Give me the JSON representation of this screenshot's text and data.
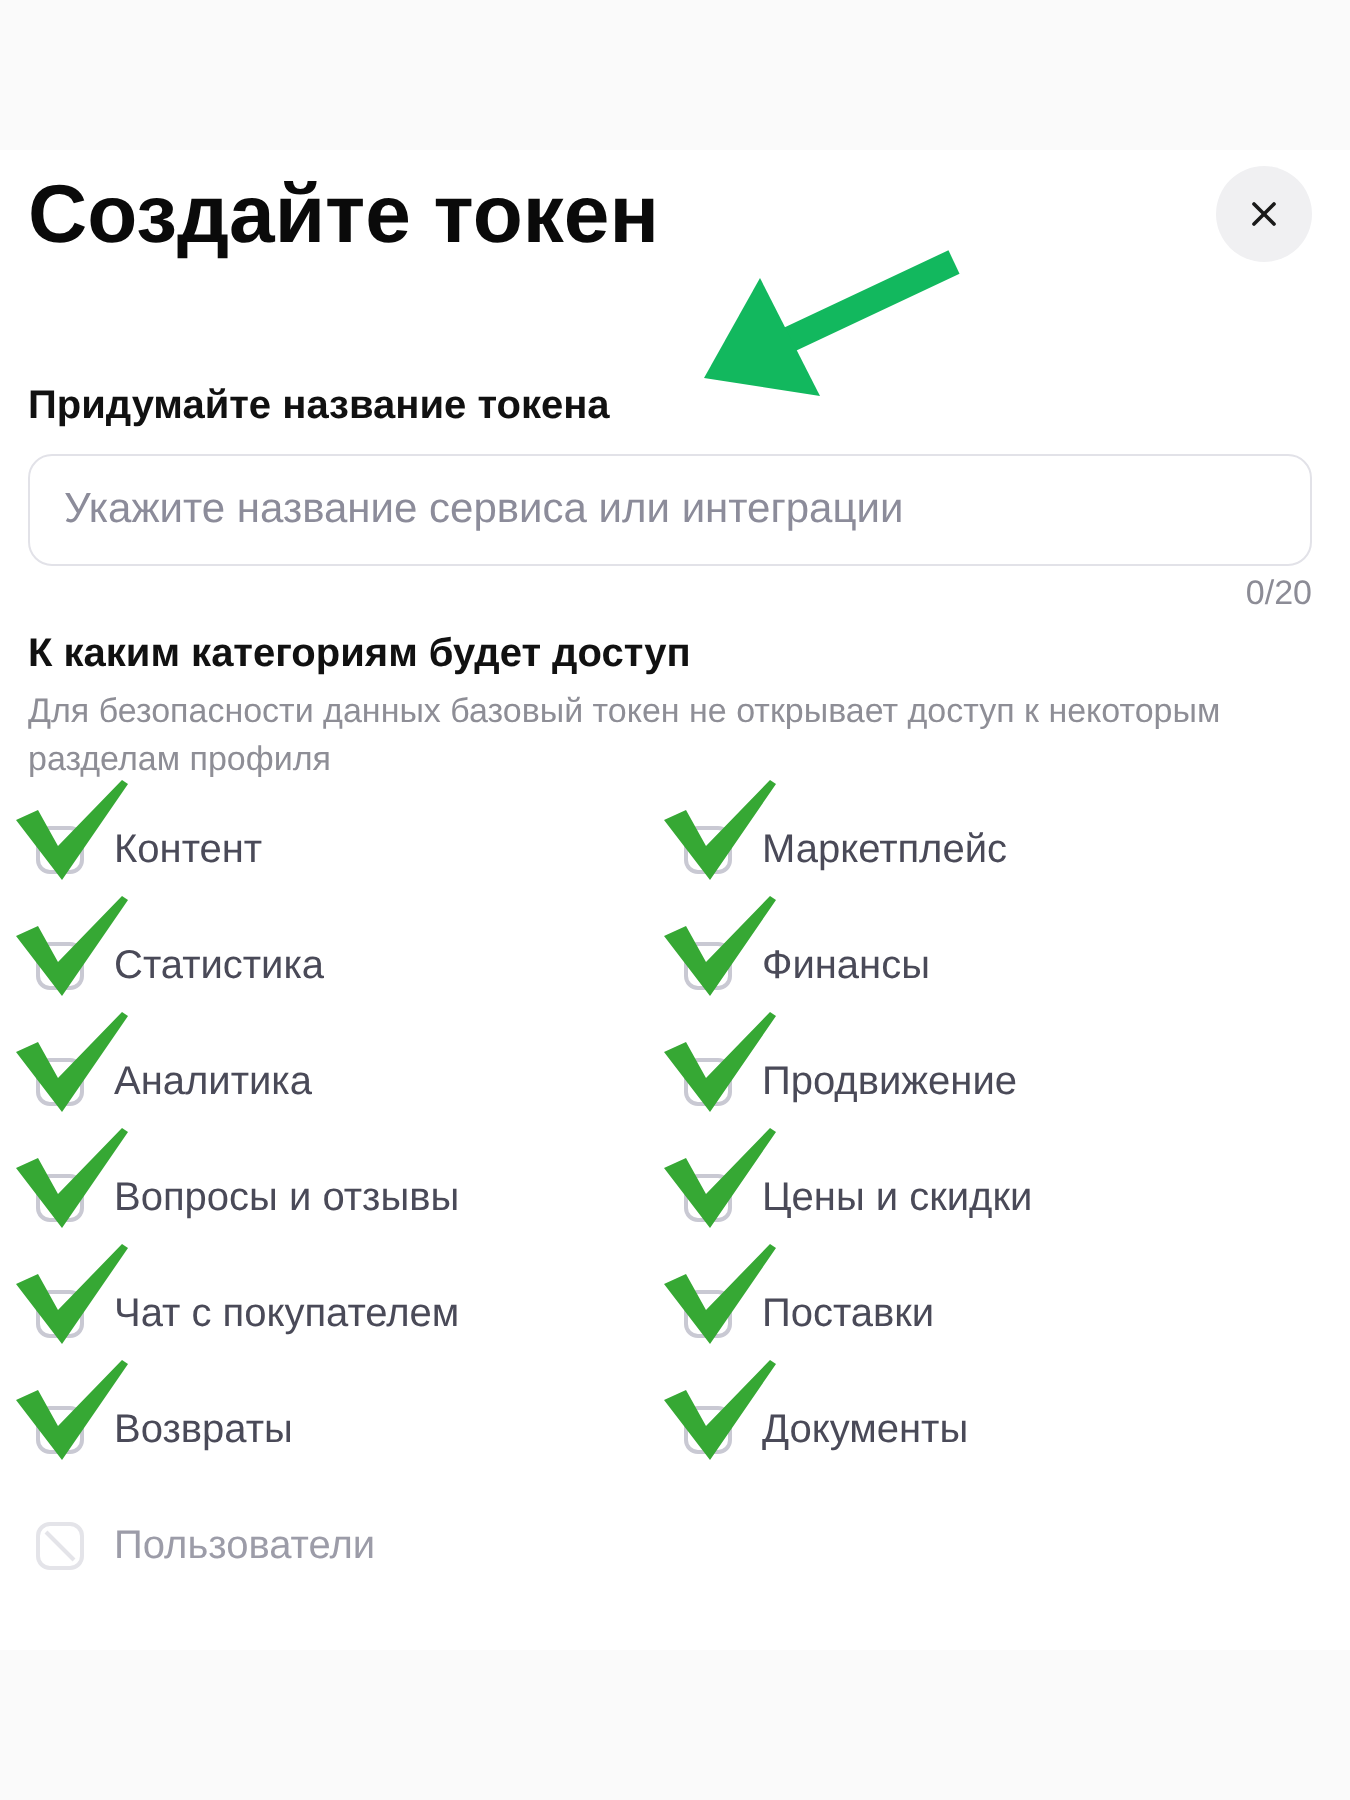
{
  "dialog": {
    "title": "Создайте токен"
  },
  "name_field": {
    "label": "Придумайте название токена",
    "placeholder": "Укажите название сервиса или интеграции",
    "counter": "0/20"
  },
  "access": {
    "title": "К каким категориям будет доступ",
    "note": "Для безопасности данных базовый токен не открывает доступ к некоторым разделам профиля",
    "categories": [
      {
        "label": "Контент",
        "checked": true,
        "disabled": false
      },
      {
        "label": "Маркетплейс",
        "checked": true,
        "disabled": false
      },
      {
        "label": "Статистика",
        "checked": true,
        "disabled": false
      },
      {
        "label": "Финансы",
        "checked": true,
        "disabled": false
      },
      {
        "label": "Аналитика",
        "checked": true,
        "disabled": false
      },
      {
        "label": "Продвижение",
        "checked": true,
        "disabled": false
      },
      {
        "label": "Вопросы и отзывы",
        "checked": true,
        "disabled": false
      },
      {
        "label": "Цены и скидки",
        "checked": true,
        "disabled": false
      },
      {
        "label": "Чат с покупателем",
        "checked": true,
        "disabled": false
      },
      {
        "label": "Поставки",
        "checked": true,
        "disabled": false
      },
      {
        "label": "Возвраты",
        "checked": true,
        "disabled": false
      },
      {
        "label": "Документы",
        "checked": true,
        "disabled": false
      },
      {
        "label": "Пользователи",
        "checked": false,
        "disabled": true
      }
    ]
  }
}
